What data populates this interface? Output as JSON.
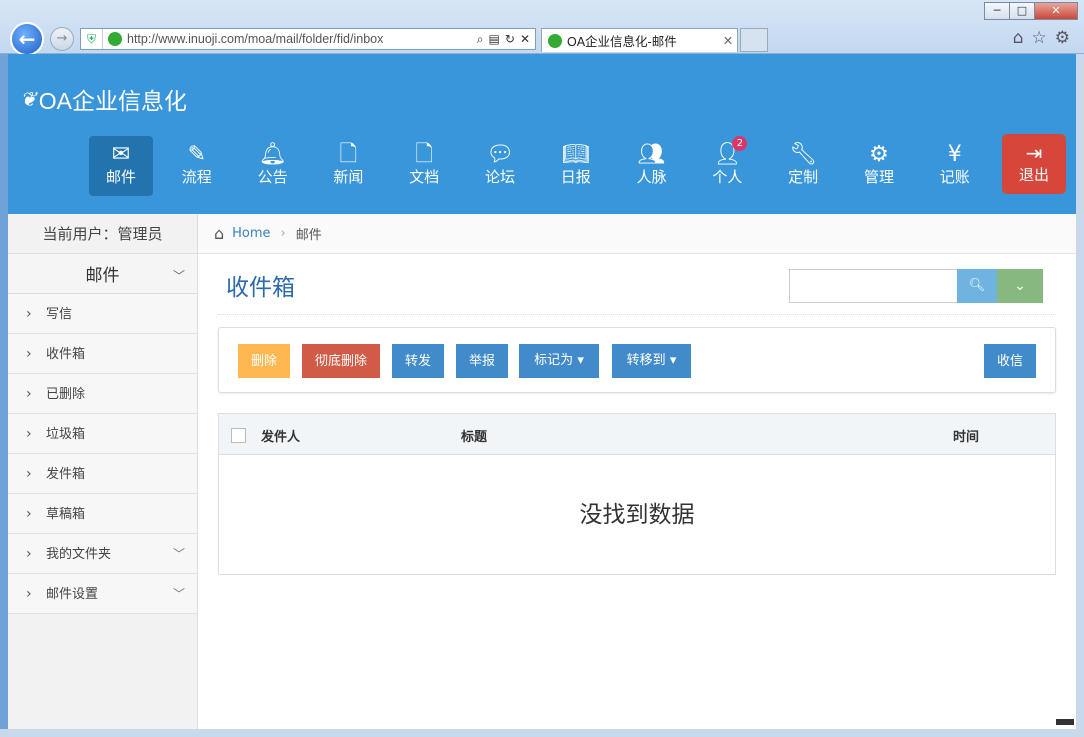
{
  "browser": {
    "url": "http://www.inuoji.com/moa/mail/folder/fid/inbox",
    "tab_title": "OA企业信息化-邮件"
  },
  "brand": {
    "name": "OA企业信息化"
  },
  "nav": {
    "items": [
      {
        "label": "邮件",
        "icon": "envelope-icon"
      },
      {
        "label": "流程",
        "icon": "pencil-icon"
      },
      {
        "label": "公告",
        "icon": "bell-icon"
      },
      {
        "label": "新闻",
        "icon": "file-icon"
      },
      {
        "label": "文档",
        "icon": "document-icon"
      },
      {
        "label": "论坛",
        "icon": "comments-icon"
      },
      {
        "label": "日报",
        "icon": "book-icon"
      },
      {
        "label": "人脉",
        "icon": "users-icon"
      },
      {
        "label": "个人",
        "icon": "user-icon",
        "badge": "2"
      },
      {
        "label": "定制",
        "icon": "wrench-icon"
      },
      {
        "label": "管理",
        "icon": "gears-icon"
      },
      {
        "label": "记账",
        "icon": "yen-icon"
      }
    ],
    "logout_label": "退出"
  },
  "sidebar": {
    "current_user": "当前用户：管理员",
    "section_title": "邮件",
    "items": [
      {
        "label": "写信"
      },
      {
        "label": "收件箱"
      },
      {
        "label": "已删除"
      },
      {
        "label": "垃圾箱"
      },
      {
        "label": "发件箱"
      },
      {
        "label": "草稿箱"
      },
      {
        "label": "我的文件夹"
      },
      {
        "label": "邮件设置"
      }
    ]
  },
  "breadcrumb": {
    "home": "Home",
    "current": "邮件"
  },
  "main": {
    "title": "收件箱",
    "search_placeholder": "",
    "buttons": {
      "delete": "删除",
      "purge": "彻底删除",
      "forward": "转发",
      "report": "举报",
      "mark": "标记为",
      "move": "转移到",
      "receive": "收信"
    },
    "table": {
      "col_sender": "发件人",
      "col_subject": "标题",
      "col_time": "时间",
      "empty_text": "没找到数据"
    }
  },
  "colors": {
    "header": "#3a96db",
    "active_nav": "#2273ae",
    "logout": "#d6463b",
    "title": "#2a6aad"
  }
}
